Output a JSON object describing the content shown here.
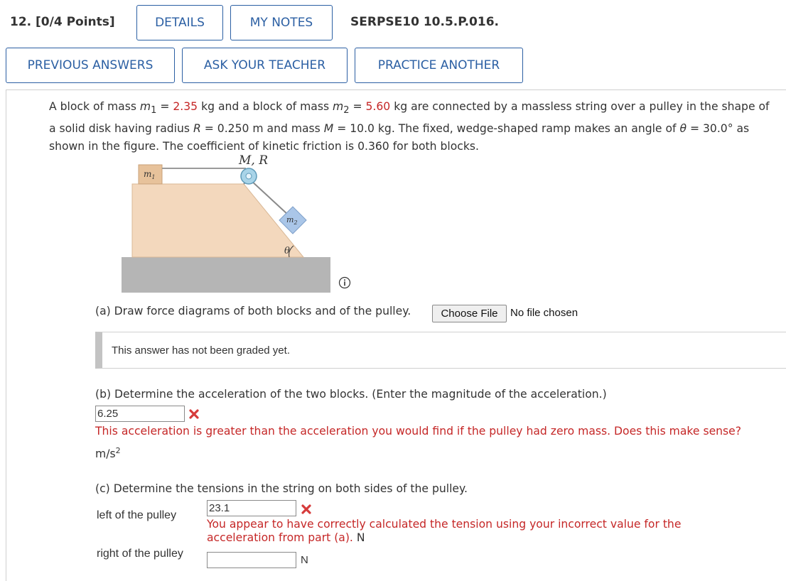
{
  "header": {
    "question_label": "12. [0/4 Points]",
    "details_label": "DETAILS",
    "notes_label": "MY NOTES",
    "problem_code": "SERPSE10 10.5.P.016.",
    "previous_answers_label": "PREVIOUS ANSWERS",
    "ask_teacher_label": "ASK YOUR TEACHER",
    "practice_another_label": "PRACTICE ANOTHER"
  },
  "problem": {
    "t1": "A block of mass ",
    "m1_sym": "m",
    "m1_sub": "1",
    "eq1": " = ",
    "m1_val": "2.35",
    "t2": " kg and a block of mass ",
    "m2_sym": "m",
    "m2_sub": "2",
    "eq2": " = ",
    "m2_val": "5.60",
    "t3": " kg are connected by a massless string over a pulley in the shape of a solid disk having radius ",
    "R_sym": "R",
    "t4": " = 0.250 m and mass ",
    "M_sym": "M",
    "t5": " = 10.0 kg. The fixed, wedge-shaped ramp makes an angle of ",
    "theta_sym": "θ",
    "t6": " = 30.0° as shown in the figure. The coefficient of kinetic friction is 0.360 for both blocks."
  },
  "figure": {
    "label_MR": "M, R",
    "label_m1": "m",
    "label_m1_sub": "1",
    "label_m2": "m",
    "label_m2_sub": "2",
    "label_theta": "θ"
  },
  "part_a": {
    "text": "(a) Draw force diagrams of both blocks and of the pulley.",
    "file_button": "Choose File",
    "file_status": "No file chosen",
    "graded_text": "This answer has not been graded yet."
  },
  "part_b": {
    "text": "(b) Determine the acceleration of the two blocks. (Enter the magnitude of the acceleration.)",
    "answer": "6.25",
    "feedback": "This acceleration is greater than the acceleration you would find if the pulley had zero mass. Does this make sense?",
    "unit": "m/s",
    "unit_exp": "2"
  },
  "part_c": {
    "text": "(c) Determine the tensions in the string on both sides of the pulley.",
    "left_label": "left of the pulley",
    "left_answer": "23.1",
    "left_feedback": "You appear to have correctly calculated the tension using your incorrect value for the acceleration from part (a).",
    "left_unit": "N",
    "right_label": "right of the pulley",
    "right_answer": "",
    "right_unit": "N"
  },
  "colors": {
    "accent": "#2b5fa3",
    "error": "#c52727",
    "ramp": "#f3d8bd",
    "ground": "#b5b5b5"
  },
  "icons": [
    "info-icon",
    "wrong-x-icon"
  ]
}
